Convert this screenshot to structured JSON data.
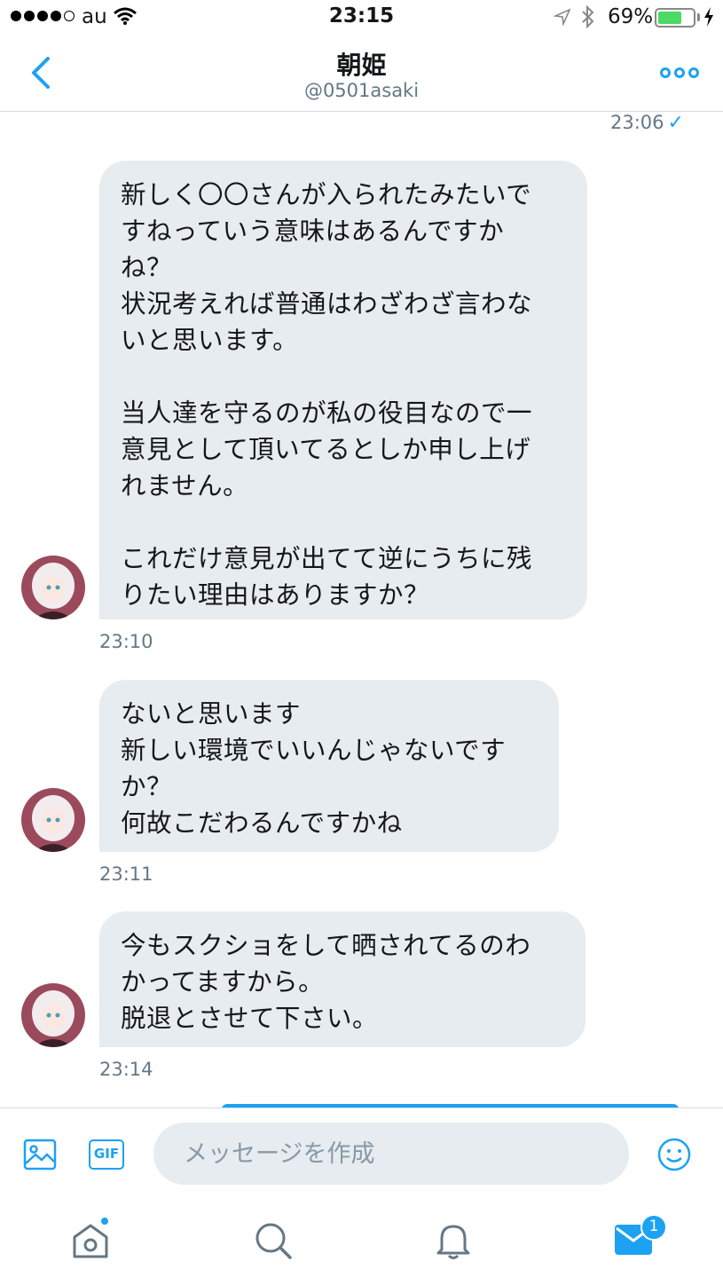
{
  "status_bar": {
    "carrier": "au",
    "time": "23:15",
    "battery_percent": "69%",
    "battery_level": 0.69
  },
  "header": {
    "title": "朝姫",
    "handle": "@0501asaki"
  },
  "conversation": {
    "sent_timestamp": "23:06",
    "messages": [
      {
        "text": "新しく〇〇さんが入られたみたいで\nすねっていう意味はあるんですか\nね？\n状況考えれば普通はわざわざ言わな\nいと思います。\n\n当人達を守るのが私の役目なので一\n意見として頂いてるとしか申し上げ\nれません。\n\nこれだけ意見が出てて逆にうちに残\nりたい理由はありますか？",
        "time": "23:10"
      },
      {
        "text": "ないと思います\n新しい環境でいいんじゃないです\nか？\n何故こだわるんですかね",
        "time": "23:11"
      },
      {
        "text": "今もスクショをして晒されてるのわ\nかってますから。\n脱退とさせて下さい。",
        "time": "23:14"
      }
    ]
  },
  "composer": {
    "placeholder": "メッセージを作成",
    "gif_label": "GIF"
  },
  "tabbar": {
    "dm_badge": "1"
  },
  "colors": {
    "accent": "#1da1f2",
    "bubble_bg": "#e6ecf0",
    "muted_text": "#657786"
  }
}
